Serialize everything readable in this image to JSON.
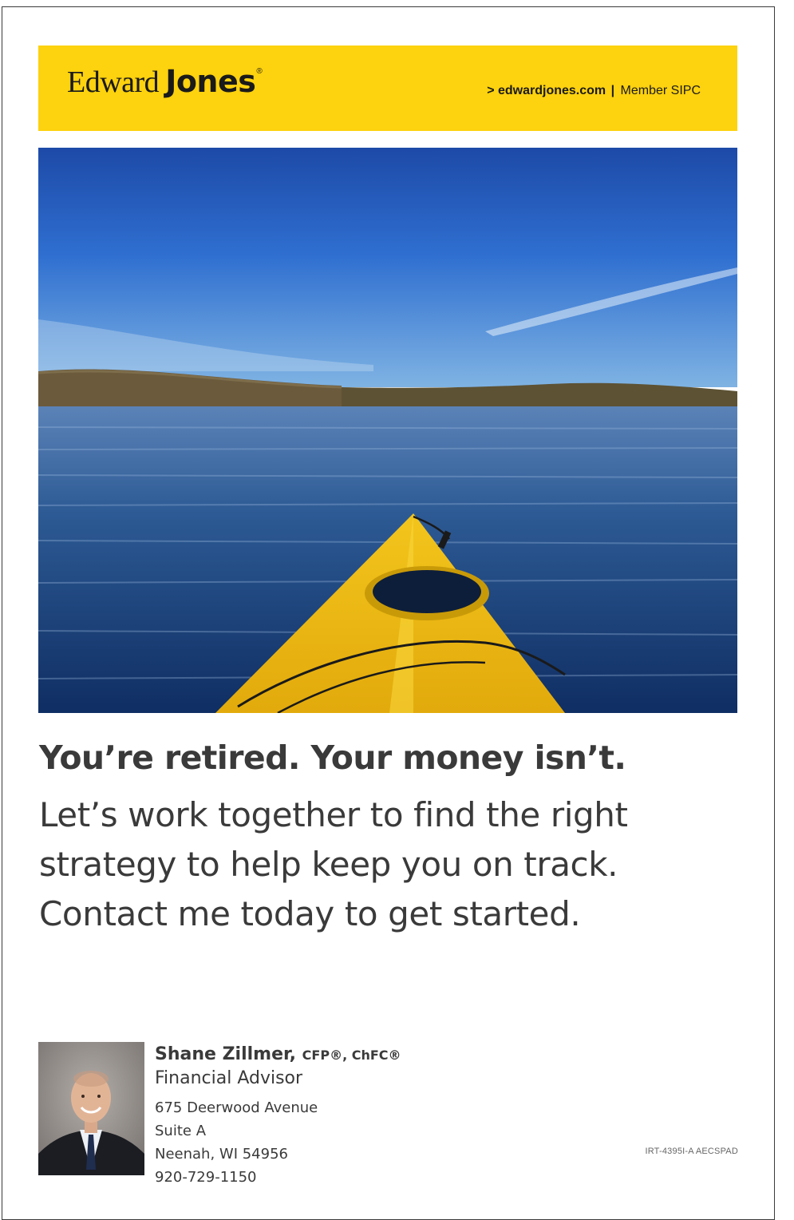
{
  "brand": {
    "logo_first": "Edward",
    "logo_last": "Jones",
    "logo_reg": "®",
    "website": "> edwardjones.com",
    "divider": "|",
    "member": "Member SIPC",
    "bar_color": "#fdd20e"
  },
  "hero_image": {
    "icon": "kayak-on-lake-photo"
  },
  "headline": "You’re retired. Your money isn’t.",
  "body_lines": [
    "Let’s work together to find the right",
    "strategy to help keep you on track.",
    "Contact me today to get started."
  ],
  "advisor": {
    "name": "Shane Zillmer,",
    "credentials": "CFP®, ChFC®",
    "title": "Financial Advisor",
    "address_line1": "675 Deerwood Avenue",
    "address_line2": "Suite A",
    "city_state_zip": "Neenah, WI 54956",
    "phone": "920-729-1150",
    "photo_icon": "advisor-headshot-photo"
  },
  "ad_code": "IRT-4395I-A  AECSPAD"
}
